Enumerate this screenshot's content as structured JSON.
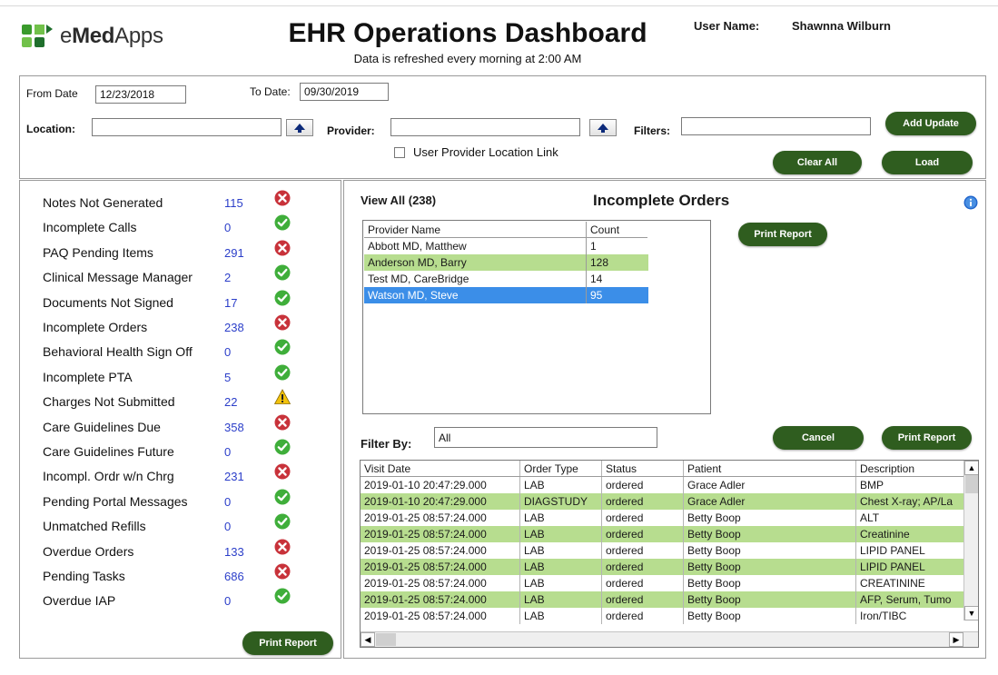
{
  "header": {
    "logo_text_bold": "Med",
    "logo_text_prefix": "e",
    "logo_text_suffix": "Apps",
    "title": "EHR Operations Dashboard",
    "subtitle": "Data is refreshed every morning at 2:00 AM",
    "user_label": "User Name:",
    "user_name": "Shawnna Wilburn"
  },
  "filters": {
    "from_date_label": "From Date",
    "from_date_value": "12/23/2018",
    "to_date_label": "To Date:",
    "to_date_value": "09/30/2019",
    "location_label": "Location:",
    "location_value": "",
    "provider_label": "Provider:",
    "provider_value": "",
    "filters_label": "Filters:",
    "filters_value": "",
    "link_checkbox_label": "User Provider Location Link",
    "add_update_label": "Add Update",
    "clear_all_label": "Clear All",
    "load_label": "Load"
  },
  "metrics": [
    {
      "label": "Notes Not Generated",
      "count": "115",
      "status": "error"
    },
    {
      "label": "Incomplete Calls",
      "count": "0",
      "status": "ok"
    },
    {
      "label": "PAQ Pending Items",
      "count": "291",
      "status": "error"
    },
    {
      "label": "Clinical Message Manager",
      "count": "2",
      "status": "ok"
    },
    {
      "label": "Documents Not Signed",
      "count": "17",
      "status": "ok"
    },
    {
      "label": "Incomplete Orders",
      "count": "238",
      "status": "error"
    },
    {
      "label": "Behavioral Health Sign Off",
      "count": "0",
      "status": "ok"
    },
    {
      "label": "Incomplete PTA",
      "count": "5",
      "status": "ok"
    },
    {
      "label": "Charges Not Submitted",
      "count": "22",
      "status": "warning"
    },
    {
      "label": "Care Guidelines Due",
      "count": "358",
      "status": "error"
    },
    {
      "label": "Care Guidelines Future",
      "count": "0",
      "status": "ok"
    },
    {
      "label": "Incompl. Ordr w/n Chrg",
      "count": "231",
      "status": "error"
    },
    {
      "label": "Pending Portal Messages",
      "count": "0",
      "status": "ok"
    },
    {
      "label": "Unmatched Refills",
      "count": "0",
      "status": "ok"
    },
    {
      "label": "Overdue Orders",
      "count": "133",
      "status": "error"
    },
    {
      "label": "Pending Tasks",
      "count": "686",
      "status": "error"
    },
    {
      "label": "Overdue IAP",
      "count": "0",
      "status": "ok"
    }
  ],
  "left_print_label": "Print Report",
  "detail": {
    "view_all": "View All (238)",
    "title": "Incomplete Orders",
    "print_label": "Print Report",
    "filter_by_label": "Filter By:",
    "filter_by_value": "All",
    "cancel_label": "Cancel",
    "print_label_2": "Print Report",
    "provider_headers": [
      "Provider Name",
      "Count"
    ],
    "providers": [
      {
        "name": "Abbott MD, Matthew",
        "count": "1",
        "style": "plain"
      },
      {
        "name": "Anderson MD, Barry",
        "count": "128",
        "style": "green"
      },
      {
        "name": "Test MD, CareBridge",
        "count": "14",
        "style": "plain"
      },
      {
        "name": "Watson MD, Steve",
        "count": "95",
        "style": "selected"
      }
    ],
    "order_headers": [
      "Visit Date",
      "Order Type",
      "Status",
      "Patient",
      "Description"
    ],
    "orders": [
      {
        "date": "2019-01-10 20:47:29.000",
        "type": "LAB",
        "status": "ordered",
        "patient": "Grace Adler",
        "desc": "BMP",
        "style": "plain"
      },
      {
        "date": "2019-01-10 20:47:29.000",
        "type": "DIAGSTUDY",
        "status": "ordered",
        "patient": "Grace Adler",
        "desc": "Chest X-ray; AP/La",
        "style": "green"
      },
      {
        "date": "2019-01-25 08:57:24.000",
        "type": "LAB",
        "status": "ordered",
        "patient": "Betty Boop",
        "desc": "ALT",
        "style": "plain"
      },
      {
        "date": "2019-01-25 08:57:24.000",
        "type": "LAB",
        "status": "ordered",
        "patient": "Betty Boop",
        "desc": "Creatinine",
        "style": "green"
      },
      {
        "date": "2019-01-25 08:57:24.000",
        "type": "LAB",
        "status": "ordered",
        "patient": "Betty Boop",
        "desc": "LIPID PANEL",
        "style": "plain"
      },
      {
        "date": "2019-01-25 08:57:24.000",
        "type": "LAB",
        "status": "ordered",
        "patient": "Betty Boop",
        "desc": "LIPID PANEL",
        "style": "green"
      },
      {
        "date": "2019-01-25 08:57:24.000",
        "type": "LAB",
        "status": "ordered",
        "patient": "Betty Boop",
        "desc": "CREATININE",
        "style": "plain"
      },
      {
        "date": "2019-01-25 08:57:24.000",
        "type": "LAB",
        "status": "ordered",
        "patient": "Betty Boop",
        "desc": "AFP, Serum, Tumo",
        "style": "green"
      },
      {
        "date": "2019-01-25 08:57:24.000",
        "type": "LAB",
        "status": "ordered",
        "patient": "Betty Boop",
        "desc": "Iron/TIBC",
        "style": "plain"
      }
    ]
  },
  "colors": {
    "accent_green": "#2f5d1f",
    "row_green": "#b7dd8f",
    "row_selected": "#3b8ee8",
    "count_blue": "#2b3ec9",
    "error_red": "#c8323a",
    "ok_green": "#3fae3a",
    "warning_yellow": "#f2c20c"
  }
}
